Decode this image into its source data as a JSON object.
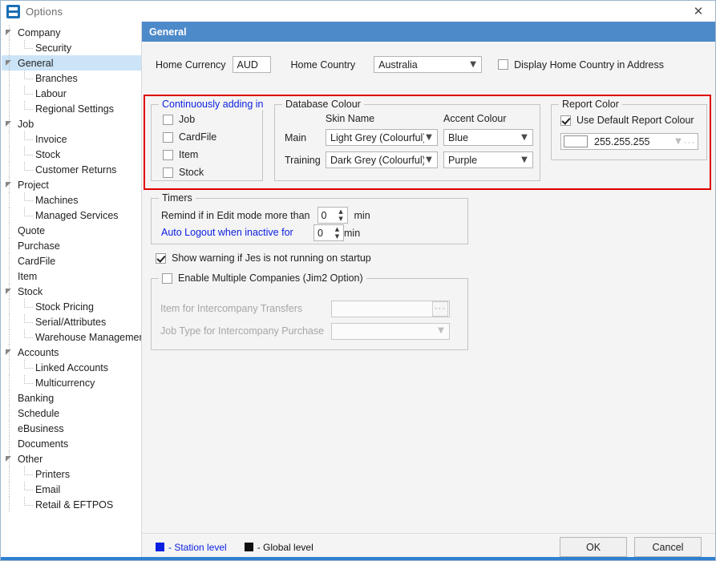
{
  "window": {
    "title": "Options",
    "icon": "app-icon",
    "close_label": "✕"
  },
  "sidebar": {
    "items": [
      {
        "label": "Company",
        "level": 0,
        "expandable": true,
        "selected": false
      },
      {
        "label": "Security",
        "level": 1,
        "expandable": false,
        "selected": false
      },
      {
        "label": "General",
        "level": 0,
        "expandable": true,
        "selected": true
      },
      {
        "label": "Branches",
        "level": 1,
        "expandable": false,
        "selected": false
      },
      {
        "label": "Labour",
        "level": 1,
        "expandable": false,
        "selected": false
      },
      {
        "label": "Regional Settings",
        "level": 1,
        "expandable": false,
        "selected": false
      },
      {
        "label": "Job",
        "level": 0,
        "expandable": true,
        "selected": false
      },
      {
        "label": "Invoice",
        "level": 1,
        "expandable": false,
        "selected": false
      },
      {
        "label": "Stock",
        "level": 1,
        "expandable": false,
        "selected": false
      },
      {
        "label": "Customer Returns",
        "level": 1,
        "expandable": false,
        "selected": false
      },
      {
        "label": "Project",
        "level": 0,
        "expandable": true,
        "selected": false
      },
      {
        "label": "Machines",
        "level": 1,
        "expandable": false,
        "selected": false
      },
      {
        "label": "Managed Services",
        "level": 1,
        "expandable": false,
        "selected": false
      },
      {
        "label": "Quote",
        "level": 0,
        "expandable": false,
        "selected": false
      },
      {
        "label": "Purchase",
        "level": 0,
        "expandable": false,
        "selected": false
      },
      {
        "label": "CardFile",
        "level": 0,
        "expandable": false,
        "selected": false
      },
      {
        "label": "Item",
        "level": 0,
        "expandable": false,
        "selected": false
      },
      {
        "label": "Stock",
        "level": 0,
        "expandable": true,
        "selected": false
      },
      {
        "label": "Stock Pricing",
        "level": 1,
        "expandable": false,
        "selected": false
      },
      {
        "label": "Serial/Attributes",
        "level": 1,
        "expandable": false,
        "selected": false
      },
      {
        "label": "Warehouse Management",
        "level": 1,
        "expandable": false,
        "selected": false
      },
      {
        "label": "Accounts",
        "level": 0,
        "expandable": true,
        "selected": false
      },
      {
        "label": "Linked Accounts",
        "level": 1,
        "expandable": false,
        "selected": false
      },
      {
        "label": "Multicurrency",
        "level": 1,
        "expandable": false,
        "selected": false
      },
      {
        "label": "Banking",
        "level": 0,
        "expandable": false,
        "selected": false
      },
      {
        "label": "Schedule",
        "level": 0,
        "expandable": false,
        "selected": false
      },
      {
        "label": "eBusiness",
        "level": 0,
        "expandable": false,
        "selected": false
      },
      {
        "label": "Documents",
        "level": 0,
        "expandable": false,
        "selected": false
      },
      {
        "label": "Other",
        "level": 0,
        "expandable": true,
        "selected": false
      },
      {
        "label": "Printers",
        "level": 1,
        "expandable": false,
        "selected": false
      },
      {
        "label": "Email",
        "level": 1,
        "expandable": false,
        "selected": false
      },
      {
        "label": "Retail & EFTPOS",
        "level": 1,
        "expandable": false,
        "selected": false
      }
    ]
  },
  "pane": {
    "header": "General"
  },
  "top_row": {
    "home_currency_label": "Home Currency",
    "home_currency_value": "AUD",
    "home_country_label": "Home Country",
    "home_country_value": "Australia",
    "display_home_country_label": "Display Home Country in Address",
    "display_home_country_checked": false
  },
  "continuously_adding": {
    "legend": "Continuously adding in",
    "items": [
      {
        "label": "Job",
        "checked": false
      },
      {
        "label": "CardFile",
        "checked": false
      },
      {
        "label": "Item",
        "checked": false
      },
      {
        "label": "Stock",
        "checked": false
      }
    ]
  },
  "database_colour": {
    "legend": "Database Colour",
    "col_skin": "Skin Name",
    "col_accent": "Accent Colour",
    "rows": [
      {
        "label": "Main",
        "skin": "Light Grey (Colourful)",
        "accent": "Blue"
      },
      {
        "label": "Training",
        "skin": "Dark Grey (Colourful)",
        "accent": "Purple"
      }
    ]
  },
  "report_color": {
    "legend": "Report Color",
    "use_default_label": "Use Default Report Colour",
    "use_default_checked": true,
    "color_value": "255.255.255",
    "swatch_hex": "#ffffff",
    "ellipsis": "···"
  },
  "timers": {
    "legend": "Timers",
    "remind_label": "Remind if in Edit mode more than",
    "remind_value": "0",
    "remind_unit": "min",
    "autologout_label": "Auto Logout when inactive for",
    "autologout_value": "0",
    "autologout_unit": "min"
  },
  "startup_warning": {
    "label": "Show warning if Jes is not running on startup",
    "checked": true
  },
  "multi_companies": {
    "legend": "Enable Multiple Companies (Jim2 Option)",
    "checked": false,
    "item_transfers_label": "Item for Intercompany Transfers",
    "item_transfers_value": "",
    "job_type_label": "Job Type for Intercompany Purchase",
    "job_type_value": "",
    "dots": "···"
  },
  "footer": {
    "station_level_label": "- Station level",
    "station_level_color": "#0b1fe0",
    "global_level_label": "- Global level",
    "global_level_color": "#111111",
    "ok_label": "OK",
    "cancel_label": "Cancel"
  }
}
